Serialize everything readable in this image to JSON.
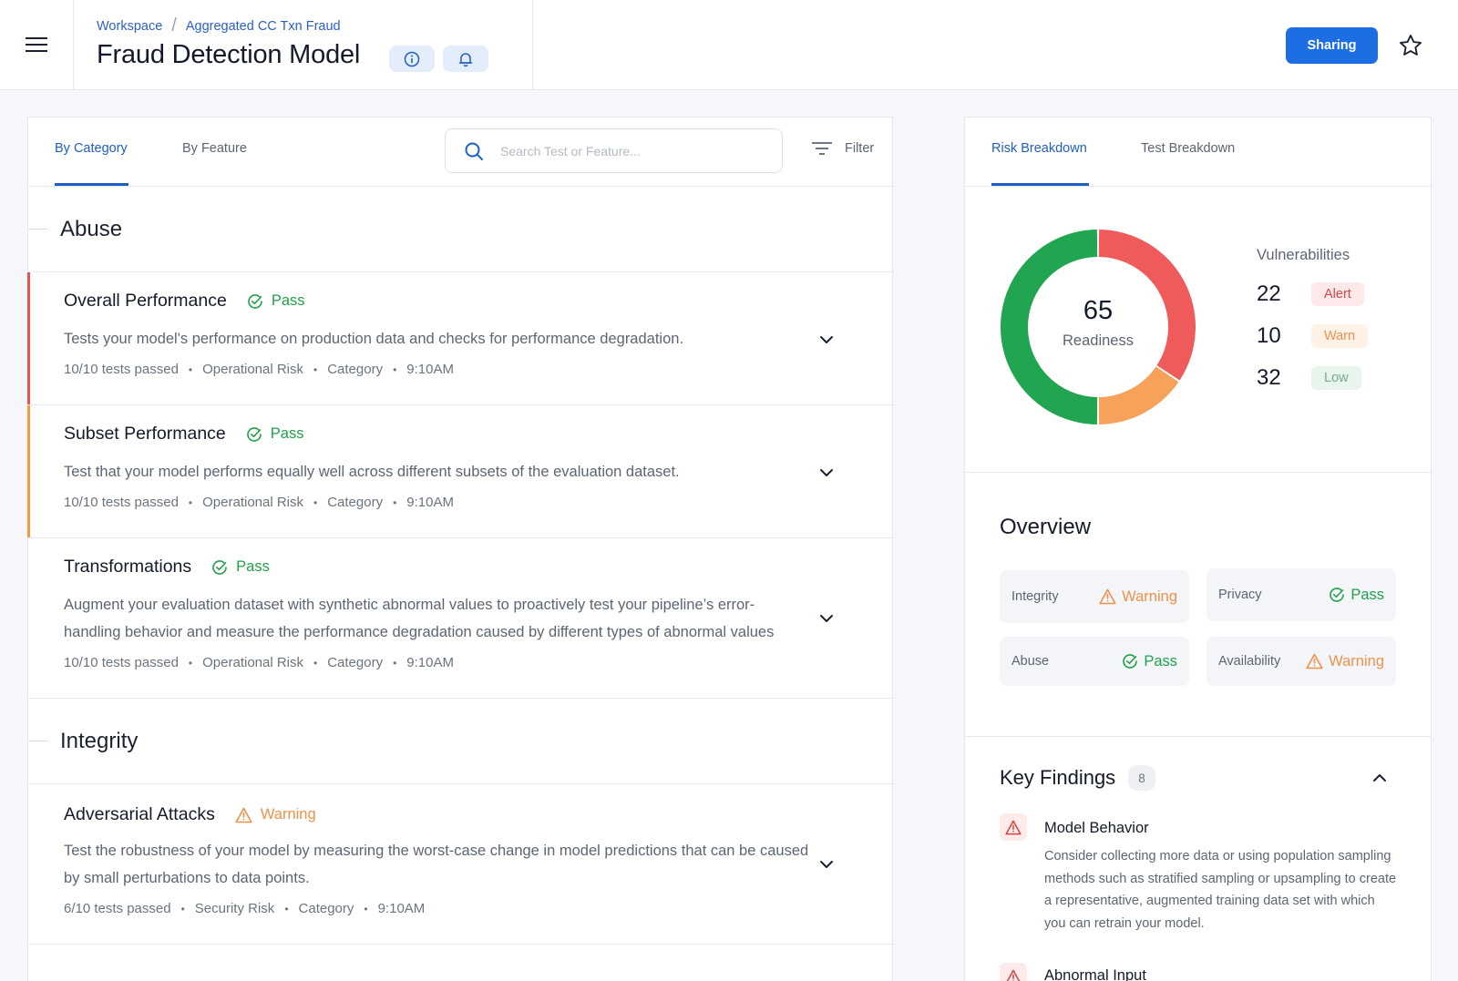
{
  "header": {
    "breadcrumb": [
      "Workspace",
      "Aggregated CC Txn Fraud"
    ],
    "title": "Fraud Detection Model",
    "sharing_label": "Sharing"
  },
  "left": {
    "tabs": [
      "By Category",
      "By Feature"
    ],
    "active_tab": "By Category",
    "search_placeholder": "Search Test or Feature...",
    "filter_label": "Filter",
    "sections": [
      {
        "name": "Abuse",
        "tests": [
          {
            "title": "Overall Performance",
            "status": "Pass",
            "description": "Tests your model's performance on production data and checks for performance degradation.",
            "meta": [
              "10/10 tests passed",
              "Operational Risk",
              "Category",
              "9:10AM"
            ],
            "accent": "#e85252"
          },
          {
            "title": "Subset Performance",
            "status": "Pass",
            "description": "Test that your model performs equally well across different subsets of the evaluation dataset.",
            "meta": [
              "10/10 tests passed",
              "Operational Risk",
              "Category",
              "9:10AM"
            ],
            "accent": "#f39b3d"
          },
          {
            "title": "Transformations",
            "status": "Pass",
            "description": "Augment your evaluation dataset with synthetic abnormal values to proactively test your pipeline’s error-handling behavior and measure the performance degradation caused by different types of abnormal values",
            "meta": [
              "10/10 tests passed",
              "Operational Risk",
              "Category",
              "9:10AM"
            ]
          }
        ]
      },
      {
        "name": "Integrity",
        "tests": [
          {
            "title": "Adversarial Attacks",
            "status": "Warning",
            "description": "Test the robustness of your model by measuring the worst-case change in model predictions that can be caused by small perturbations to data points.",
            "meta": [
              "6/10 tests passed",
              "Security Risk",
              "Category",
              "9:10AM"
            ]
          }
        ]
      }
    ]
  },
  "right": {
    "tabs": [
      "Risk Breakdown",
      "Test Breakdown"
    ],
    "active_tab": "Risk Breakdown",
    "readiness": {
      "value": "65",
      "label": "Readiness"
    },
    "donut": [
      {
        "name": "Alert",
        "value": 22,
        "color": "#ef5a5a"
      },
      {
        "name": "Warn",
        "value": 10,
        "color": "#f7a25a"
      },
      {
        "name": "Low",
        "value": 32,
        "color": "#22a550"
      }
    ],
    "vulnerabilities": {
      "title": "Vulnerabilities",
      "rows": [
        {
          "count": "22",
          "label": "Alert",
          "fg": "#d64545",
          "bg": "#fde9e9"
        },
        {
          "count": "10",
          "label": "Warn",
          "fg": "#f0914b",
          "bg": "#fef2e6"
        },
        {
          "count": "32",
          "label": "Low",
          "fg": "#7aa88a",
          "bg": "#e7f5ec"
        }
      ]
    },
    "overview": {
      "title": "Overview",
      "items": [
        {
          "label": "Integrity",
          "status": "Warning"
        },
        {
          "label": "Privacy",
          "status": "Pass"
        },
        {
          "label": "Abuse",
          "status": "Pass"
        },
        {
          "label": "Availability",
          "status": "Warning"
        }
      ]
    },
    "key_findings": {
      "title": "Key Findings",
      "count": "8",
      "items": [
        {
          "title": "Model Behavior",
          "body": "Consider collecting more data or using population sampling methods such as stratified sampling or upsampling to create a representative, augmented training data set with which you can retrain your model."
        },
        {
          "title": "Abnormal Input",
          "body": ""
        }
      ]
    }
  }
}
